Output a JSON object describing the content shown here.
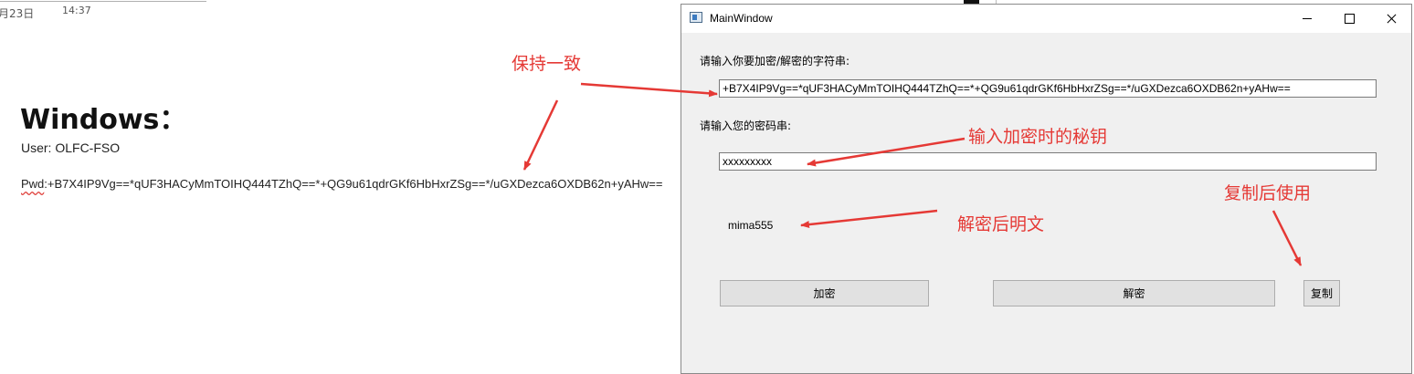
{
  "note": {
    "date_fragment": "月23日",
    "time": "14:37",
    "title": "Windows：",
    "user_line": "User: OLFC-FSO",
    "pwd_label": "Pwd",
    "pwd_value": ":+B7X4IP9Vg==*qUF3HACyMmTOIHQ444TZhQ==*+QG9u61qdrGKf6HbHxrZSg==*/uGXDezca6OXDB62n+yAHw=="
  },
  "window": {
    "title": "MainWindow",
    "input_label": "请输入你要加密/解密的字符串:",
    "input_value": "+B7X4IP9Vg==*qUF3HACyMmTOIHQ444TZhQ==*+QG9u61qdrGKf6HbHxrZSg==*/uGXDezca6OXDB62n+yAHw==",
    "key_label": "请输入您的密码串:",
    "key_value": "xxxxxxxxx",
    "output_text": "mima555",
    "encrypt_button": "加密",
    "decrypt_button": "解密",
    "copy_button": "复制"
  },
  "annotations": {
    "keep_consistent": "保持一致",
    "enter_key": "输入加密时的秘钥",
    "decrypted_plaintext": "解密后明文",
    "copy_then_use": "复制后使用",
    "color": "#e53935"
  }
}
